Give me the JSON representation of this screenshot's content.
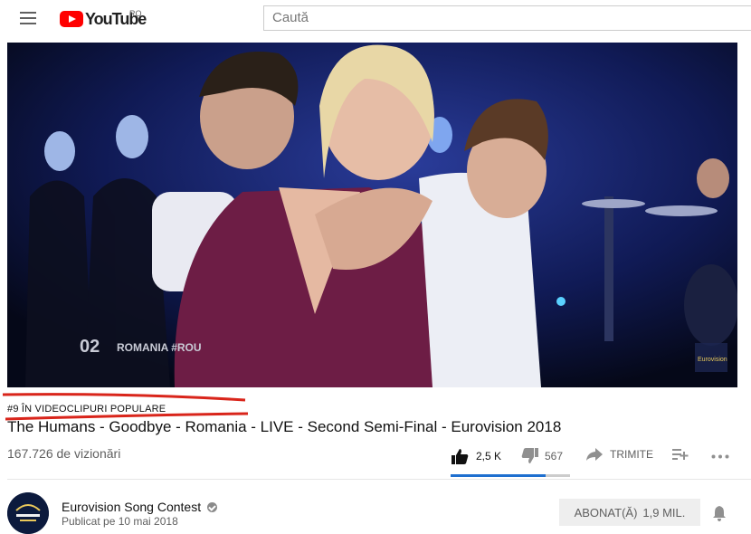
{
  "header": {
    "logo_text": "YouTube",
    "country": "RO",
    "search_placeholder": "Caută"
  },
  "video": {
    "overlay_text": "02 ROMANIA #ROU",
    "watermark_text": "Eurovision"
  },
  "trending": "#9 ÎN VIDEOCLIPURI POPULARE",
  "title": "The Humans - Goodbye - Romania - LIVE - Second Semi-Final - Eurovision 2018",
  "views": "167.726 de vizionări",
  "actions": {
    "likes": "2,5 K",
    "dislikes": "567",
    "share": "TRIMITE",
    "like_ratio": 0.815
  },
  "channel": {
    "name": "Eurovision Song Contest",
    "published": "Publicat pe 10 mai 2018",
    "subscribe_label": "ABONAT(Ă)",
    "subscriber_count": "1,9 MIL."
  },
  "colors": {
    "brand": "#ff0000",
    "annotation": "#d9251b",
    "like_bar": "#1e6fcf"
  }
}
